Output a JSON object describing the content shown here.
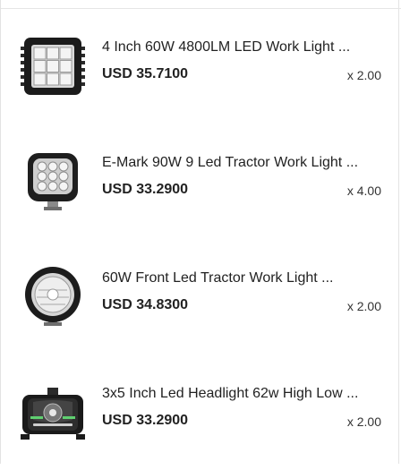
{
  "cart": {
    "items": [
      {
        "title": "4 Inch 60W 4800LM LED Work Light ...",
        "price": "USD 35.7100",
        "quantity": "x 2.00",
        "thumbnail": "square-led-work-light"
      },
      {
        "title": "E-Mark 90W 9 Led Tractor Work Light ...",
        "price": "USD 33.2900",
        "quantity": "x 4.00",
        "thumbnail": "rounded-square-led-work-light"
      },
      {
        "title": "60W Front Led Tractor Work Light ...",
        "price": "USD 34.8300",
        "quantity": "x 2.00",
        "thumbnail": "round-led-work-light"
      },
      {
        "title": "3x5 Inch Led Headlight 62w High Low ...",
        "price": "USD 33.2900",
        "quantity": "x 2.00",
        "thumbnail": "rectangular-led-headlight"
      }
    ]
  }
}
